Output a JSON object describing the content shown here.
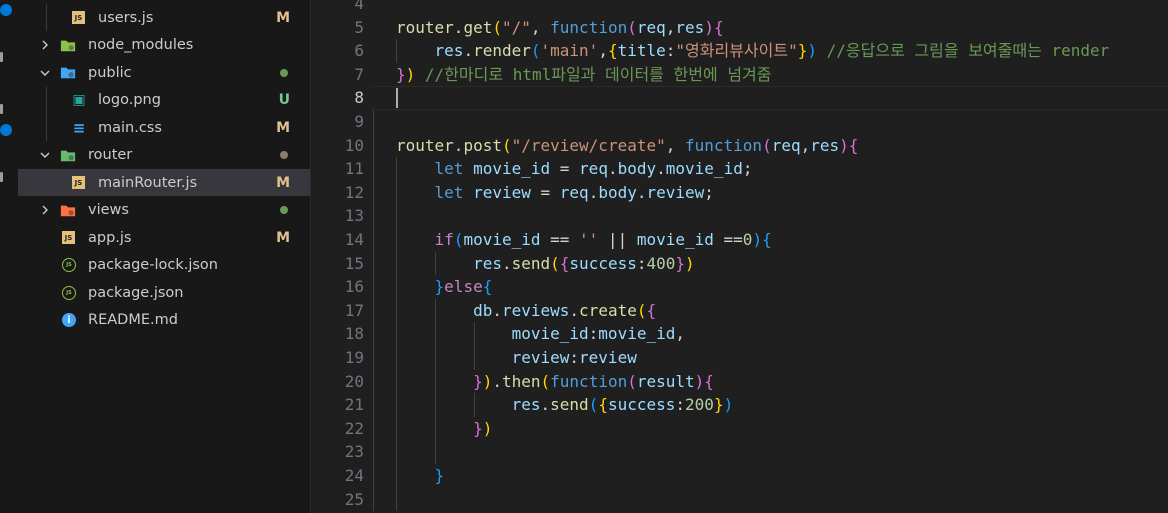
{
  "explorer": {
    "items": [
      {
        "label": "users.js",
        "type": "file",
        "icon": "js-icon",
        "status": "M"
      },
      {
        "label": "node_modules",
        "type": "folder",
        "icon": "node-modules-folder-icon",
        "expanded": false
      },
      {
        "label": "public",
        "type": "folder",
        "icon": "public-folder-icon",
        "expanded": true,
        "dot": "#6a9955"
      },
      {
        "label": "logo.png",
        "type": "file",
        "icon": "image-icon",
        "status": "U"
      },
      {
        "label": "main.css",
        "type": "file",
        "icon": "css-icon",
        "status": "M"
      },
      {
        "label": "router",
        "type": "folder",
        "icon": "router-folder-icon",
        "expanded": true,
        "dot": "#8a7f66"
      },
      {
        "label": "mainRouter.js",
        "type": "file",
        "icon": "js-icon",
        "status": "M",
        "selected": true
      },
      {
        "label": "views",
        "type": "folder",
        "icon": "views-folder-icon",
        "expanded": false,
        "dot": "#6a9955"
      },
      {
        "label": "app.js",
        "type": "file",
        "icon": "js-icon",
        "status": "M"
      },
      {
        "label": "package-lock.json",
        "type": "file",
        "icon": "node-json-icon"
      },
      {
        "label": "package.json",
        "type": "file",
        "icon": "node-json-icon"
      },
      {
        "label": "README.md",
        "type": "file",
        "icon": "info-icon"
      }
    ]
  },
  "editor": {
    "active_line": "8",
    "lines": [
      {
        "n": "4",
        "tokens": []
      },
      {
        "n": "5",
        "tokens": [
          [
            "fn",
            "router"
          ],
          [
            "",
            "."
          ],
          [
            "fn",
            "get"
          ],
          [
            "p1",
            "("
          ],
          [
            "str",
            "\"/\""
          ],
          [
            "",
            ", "
          ],
          [
            "kw",
            "function"
          ],
          [
            "p2",
            "("
          ],
          [
            "var",
            "req"
          ],
          [
            "",
            ","
          ],
          [
            "var",
            "res"
          ],
          [
            "p2",
            ")"
          ],
          [
            "p2",
            "{"
          ]
        ]
      },
      {
        "n": "6",
        "tokens": [
          [
            "",
            "    "
          ],
          [
            "var",
            "res"
          ],
          [
            "",
            "."
          ],
          [
            "fn",
            "render"
          ],
          [
            "p3",
            "("
          ],
          [
            "str",
            "'main'"
          ],
          [
            "",
            ","
          ],
          [
            "p1",
            "{"
          ],
          [
            "var",
            "title"
          ],
          [
            "",
            ":"
          ],
          [
            "str",
            "\"영화리뷰사이트\""
          ],
          [
            "p1",
            "}"
          ],
          [
            "p3",
            ")"
          ],
          [
            "",
            " "
          ],
          [
            "cm",
            "//응답으로 그림을 보여줄때는 render"
          ]
        ]
      },
      {
        "n": "7",
        "tokens": [
          [
            "p2",
            "}"
          ],
          [
            "p1",
            ")"
          ],
          [
            "",
            " "
          ],
          [
            "cm",
            "//한마디로 html파일과 데이터를 한번에 넘겨줌"
          ]
        ]
      },
      {
        "n": "8",
        "tokens": []
      },
      {
        "n": "9",
        "tokens": []
      },
      {
        "n": "10",
        "tokens": [
          [
            "fn",
            "router"
          ],
          [
            "",
            "."
          ],
          [
            "fn",
            "post"
          ],
          [
            "p1",
            "("
          ],
          [
            "str",
            "\"/review/create\""
          ],
          [
            "",
            ", "
          ],
          [
            "kw",
            "function"
          ],
          [
            "p2",
            "("
          ],
          [
            "var",
            "req"
          ],
          [
            "",
            ","
          ],
          [
            "var",
            "res"
          ],
          [
            "p2",
            ")"
          ],
          [
            "p2",
            "{"
          ]
        ]
      },
      {
        "n": "11",
        "tokens": [
          [
            "",
            "    "
          ],
          [
            "kw",
            "let"
          ],
          [
            "",
            " "
          ],
          [
            "var",
            "movie_id"
          ],
          [
            "",
            " = "
          ],
          [
            "var",
            "req"
          ],
          [
            "",
            "."
          ],
          [
            "var",
            "body"
          ],
          [
            "",
            "."
          ],
          [
            "var",
            "movie_id"
          ],
          [
            "",
            ";"
          ]
        ]
      },
      {
        "n": "12",
        "tokens": [
          [
            "",
            "    "
          ],
          [
            "kw",
            "let"
          ],
          [
            "",
            " "
          ],
          [
            "var",
            "review"
          ],
          [
            "",
            " = "
          ],
          [
            "var",
            "req"
          ],
          [
            "",
            "."
          ],
          [
            "var",
            "body"
          ],
          [
            "",
            "."
          ],
          [
            "var",
            "review"
          ],
          [
            "",
            ";"
          ]
        ]
      },
      {
        "n": "13",
        "tokens": []
      },
      {
        "n": "14",
        "tokens": [
          [
            "",
            "    "
          ],
          [
            "ctl",
            "if"
          ],
          [
            "p3",
            "("
          ],
          [
            "var",
            "movie_id"
          ],
          [
            "",
            " == "
          ],
          [
            "str",
            "''"
          ],
          [
            "",
            " || "
          ],
          [
            "var",
            "movie_id"
          ],
          [
            "",
            " =="
          ],
          [
            "num",
            "0"
          ],
          [
            "p3",
            ")"
          ],
          [
            "p3",
            "{"
          ]
        ]
      },
      {
        "n": "15",
        "tokens": [
          [
            "",
            "        "
          ],
          [
            "var",
            "res"
          ],
          [
            "",
            "."
          ],
          [
            "fn",
            "send"
          ],
          [
            "p1",
            "("
          ],
          [
            "p2",
            "{"
          ],
          [
            "var",
            "success"
          ],
          [
            "",
            ":"
          ],
          [
            "num",
            "400"
          ],
          [
            "p2",
            "}"
          ],
          [
            "p1",
            ")"
          ]
        ]
      },
      {
        "n": "16",
        "tokens": [
          [
            "",
            "    "
          ],
          [
            "p3",
            "}"
          ],
          [
            "ctl",
            "else"
          ],
          [
            "p3",
            "{"
          ]
        ]
      },
      {
        "n": "17",
        "tokens": [
          [
            "",
            "        "
          ],
          [
            "var",
            "db"
          ],
          [
            "",
            "."
          ],
          [
            "var",
            "reviews"
          ],
          [
            "",
            "."
          ],
          [
            "fn",
            "create"
          ],
          [
            "p1",
            "("
          ],
          [
            "p2",
            "{"
          ]
        ]
      },
      {
        "n": "18",
        "tokens": [
          [
            "",
            "            "
          ],
          [
            "var",
            "movie_id"
          ],
          [
            "",
            ":"
          ],
          [
            "var",
            "movie_id"
          ],
          [
            "",
            ","
          ]
        ]
      },
      {
        "n": "19",
        "tokens": [
          [
            "",
            "            "
          ],
          [
            "var",
            "review"
          ],
          [
            "",
            ":"
          ],
          [
            "var",
            "review"
          ]
        ]
      },
      {
        "n": "20",
        "tokens": [
          [
            "",
            "        "
          ],
          [
            "p2",
            "}"
          ],
          [
            "p1",
            ")"
          ],
          [
            "",
            "."
          ],
          [
            "fn",
            "then"
          ],
          [
            "p1",
            "("
          ],
          [
            "kw",
            "function"
          ],
          [
            "p2",
            "("
          ],
          [
            "var",
            "result"
          ],
          [
            "p2",
            ")"
          ],
          [
            "p2",
            "{"
          ]
        ]
      },
      {
        "n": "21",
        "tokens": [
          [
            "",
            "            "
          ],
          [
            "var",
            "res"
          ],
          [
            "",
            "."
          ],
          [
            "fn",
            "send"
          ],
          [
            "p3",
            "("
          ],
          [
            "p1",
            "{"
          ],
          [
            "var",
            "success"
          ],
          [
            "",
            ":"
          ],
          [
            "num",
            "200"
          ],
          [
            "p1",
            "}"
          ],
          [
            "p3",
            ")"
          ]
        ]
      },
      {
        "n": "22",
        "tokens": [
          [
            "",
            "        "
          ],
          [
            "p2",
            "}"
          ],
          [
            "p1",
            ")"
          ]
        ]
      },
      {
        "n": "23",
        "tokens": []
      },
      {
        "n": "24",
        "tokens": [
          [
            "",
            "    "
          ],
          [
            "p3",
            "}"
          ]
        ]
      },
      {
        "n": "25",
        "tokens": []
      }
    ]
  },
  "colors": {
    "status_modified": "#e2c08d",
    "status_untracked": "#73c991",
    "selection": "#37373d",
    "accent": "#0078d4"
  }
}
